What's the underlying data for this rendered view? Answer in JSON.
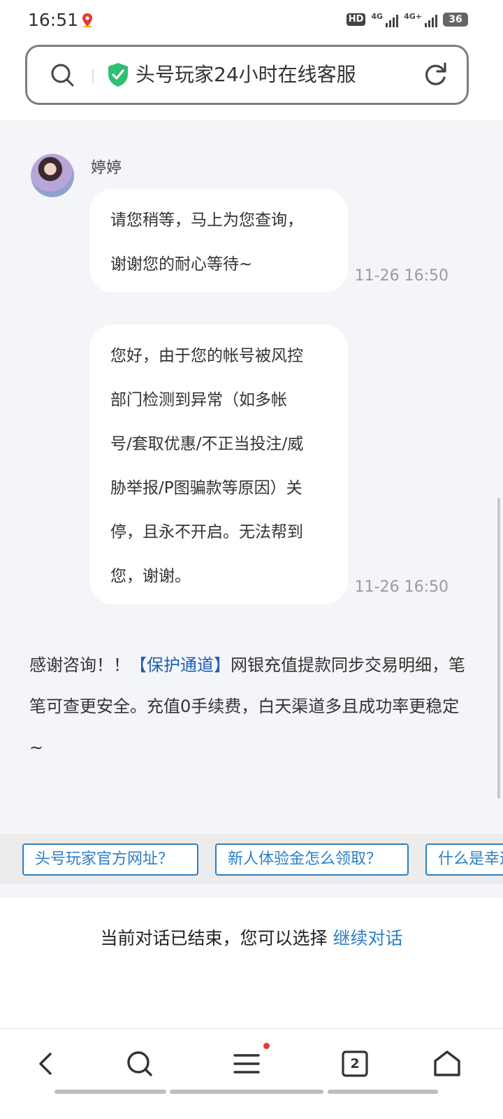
{
  "status_bar": {
    "time": "16:51",
    "hd_label": "HD",
    "signal1_label": "4G",
    "signal2_label": "4G+",
    "battery": "36"
  },
  "search_bar": {
    "title": "头号玩家24小时在线客服",
    "icons": [
      "search-icon",
      "shield-check-icon",
      "refresh-icon"
    ]
  },
  "chat": {
    "agent_name": "婷婷",
    "messages": [
      {
        "lines": [
          "请您稍等，马上为您查询，",
          "谢谢您的耐心等待~"
        ],
        "time": "11-26 16:50"
      },
      {
        "lines": [
          "您好，由于您的帐号被风控",
          "部门检测到异常（如多帐",
          "号/套取优惠/不正当投注/威",
          "胁举报/P图骗款等原因）关",
          "停，且永不开启。无法帮到",
          "您，谢谢。"
        ],
        "time": "11-26 16:50"
      }
    ],
    "notice": {
      "prefix": "感谢咨询！！",
      "link": "【保护通道】",
      "suffix": "网银充值提款同步交易明细，笔笔可查更安全。充值0手续费，白天渠道多且成功率更稳定~"
    }
  },
  "quick_replies": [
    "头号玩家官方网址？",
    "新人体验金怎么领取？",
    "什么是幸运"
  ],
  "ended": {
    "text": "当前对话已结束，您可以选择",
    "action": "继续对话"
  },
  "nav": {
    "tabs_count": "2",
    "icons": [
      "back-icon",
      "search-icon",
      "menu-icon",
      "tabs-icon",
      "home-icon"
    ]
  },
  "colors": {
    "link": "#1f5fb5",
    "chip": "#2d7ec4",
    "chat_bg": "#f3f5f8",
    "shield": "#2fbf71",
    "badge": "#e53935"
  }
}
